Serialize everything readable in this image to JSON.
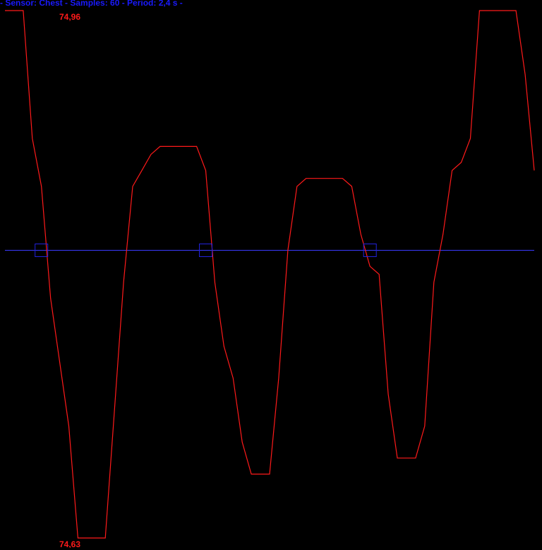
{
  "header": {
    "text": "- Sensor: Chest - Samples: 60 - Period: 2,4 s -"
  },
  "labels": {
    "max": "74,96",
    "min": "74,63"
  },
  "colors": {
    "background": "#000000",
    "signal": "#ff1a1a",
    "baseline": "#3a3aff",
    "marker": "#2222dd",
    "header": "#1a1aff",
    "value_labels": "#ff1a1a"
  },
  "chart_data": {
    "type": "line",
    "title": "- Sensor: Chest - Samples: 60 - Period: 2,4 s -",
    "xlabel": "",
    "ylabel": "",
    "ylim": [
      74.63,
      74.96
    ],
    "grid": false,
    "series": [
      {
        "values": [
          74.96,
          74.96,
          74.96,
          74.88,
          74.85,
          74.78,
          74.74,
          74.7,
          74.63,
          74.63,
          74.63,
          74.63,
          74.71,
          74.79,
          74.85,
          74.86,
          74.87,
          74.875,
          74.875,
          74.875,
          74.875,
          74.875,
          74.86,
          74.79,
          74.75,
          74.73,
          74.69,
          74.67,
          74.67,
          74.67,
          74.73,
          74.81,
          74.85,
          74.855,
          74.855,
          74.855,
          74.855,
          74.855,
          74.85,
          74.82,
          74.8,
          74.795,
          74.72,
          74.68,
          74.68,
          74.68,
          74.7,
          74.79,
          74.82,
          74.86,
          74.865,
          74.88,
          74.96,
          74.96,
          74.96,
          74.96,
          74.96,
          74.92,
          74.86
        ]
      }
    ],
    "baseline": 74.81,
    "markers_at_indices": [
      4,
      22,
      40
    ]
  }
}
